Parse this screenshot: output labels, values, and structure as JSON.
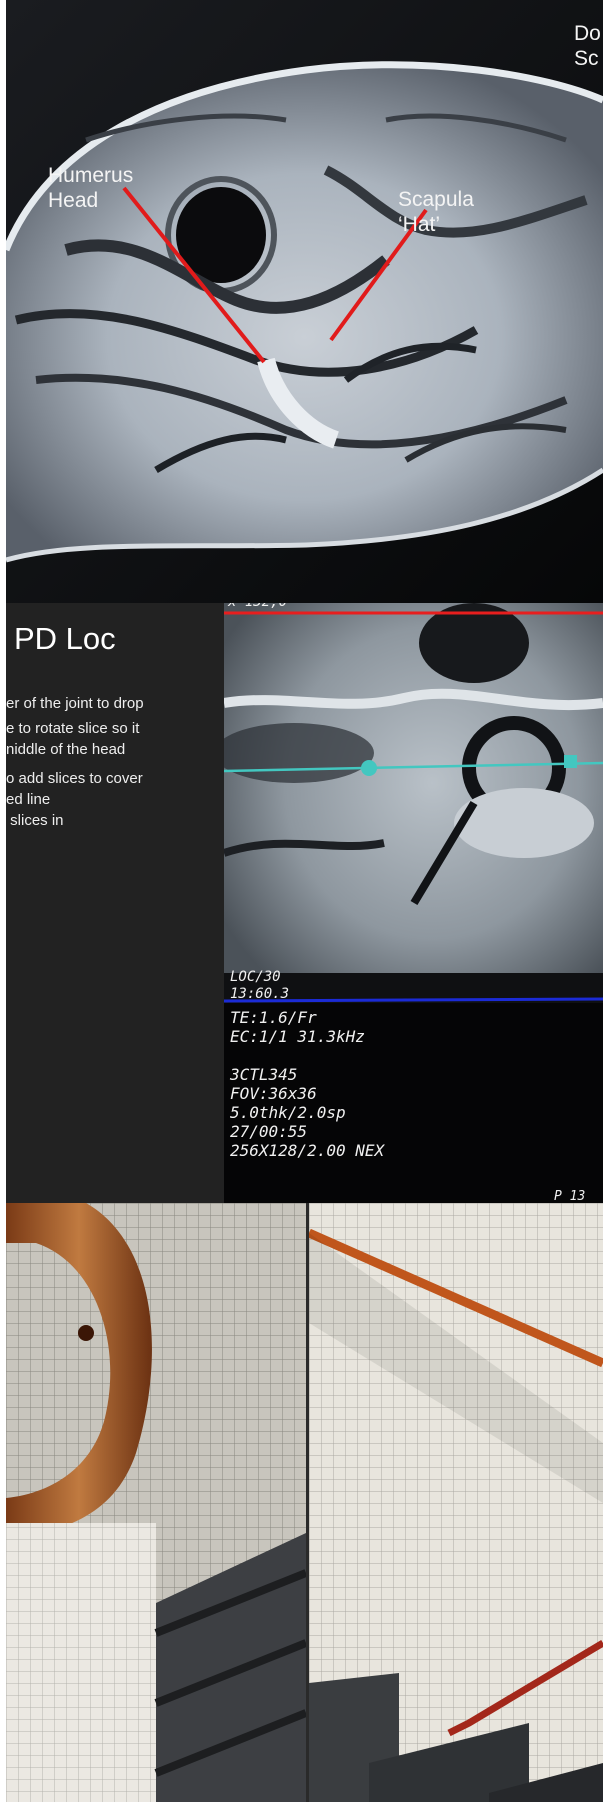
{
  "mri_panel": {
    "labels": {
      "humerus": "Humerus\nHead",
      "scapula": "Scapula\n‘Hat’",
      "corner": "Do\nSc"
    },
    "annotation_color": "#e11b1b"
  },
  "slide": {
    "title": "PD Loc",
    "bullets": [
      "er of the joint to drop",
      "e to rotate slice so it\nniddle of the head",
      "o add slices to cover\ned line\n slices in"
    ]
  },
  "scanner": {
    "top_text": "x 132,0",
    "console_lines": [
      "LOC/30",
      "13:60.3",
      "TE:1.6/Fr",
      "EC:1/1 31.3kHz",
      "",
      "3CTL345",
      "FOV:36x36",
      "5.0thk/2.0sp",
      "27/00:55",
      "256X128/2.00 NEX"
    ],
    "corner_text": "P 13",
    "line_colors": {
      "red": "#e81e1e",
      "cyan": "#43c7c0",
      "blue": "#1b2bd6"
    }
  }
}
